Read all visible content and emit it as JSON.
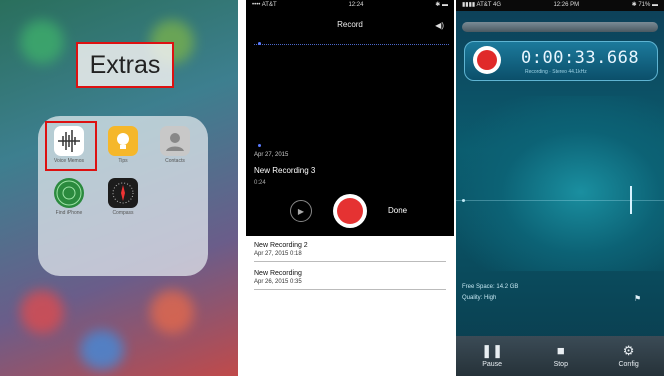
{
  "panel1": {
    "folder_name": "Extras",
    "apps": [
      {
        "name": "Voice Memos",
        "icon": "voice-memos-icon",
        "color": "#ffffff"
      },
      {
        "name": "Tips",
        "icon": "tips-icon",
        "color": "#f5b72a"
      },
      {
        "name": "Contacts",
        "icon": "contacts-icon",
        "color": "#c8c8c8"
      },
      {
        "name": "Find iPhone",
        "icon": "find-iphone-icon",
        "color": "#2b8a3e"
      },
      {
        "name": "Compass",
        "icon": "compass-icon",
        "color": "#1c1c1c"
      }
    ],
    "highlight_color": "#dd1111"
  },
  "panel2": {
    "status_left": "•••• AT&T",
    "status_time": "12:24",
    "status_right": "✱ ▬",
    "title": "Record",
    "recording": {
      "date": "Apr 27, 2015",
      "name": "New Recording 3",
      "duration": "0:24"
    },
    "done_label": "Done",
    "list": [
      {
        "title": "New Recording 2",
        "sub": "Apr 27, 2015 0:18"
      },
      {
        "title": "New Recording",
        "sub": "Apr 26, 2015 0:35"
      }
    ],
    "record_color": "#e53232"
  },
  "panel3": {
    "status_left": "▮▮▮▮ AT&T 4G",
    "status_time": "12:26 PM",
    "status_right": "✱ 71% ▬",
    "timer": "0:00:33.668",
    "meta": "Recording  ·  Stereo  44.1kHz",
    "info1": "Free Space: 14.2 GB",
    "info2": "Quality: High",
    "toolbar": [
      {
        "label": "Pause",
        "icon": "pause-icon"
      },
      {
        "label": "Stop",
        "icon": "stop-icon"
      },
      {
        "label": "Config",
        "icon": "gear-icon"
      }
    ],
    "accent": "#1c7a9c"
  }
}
